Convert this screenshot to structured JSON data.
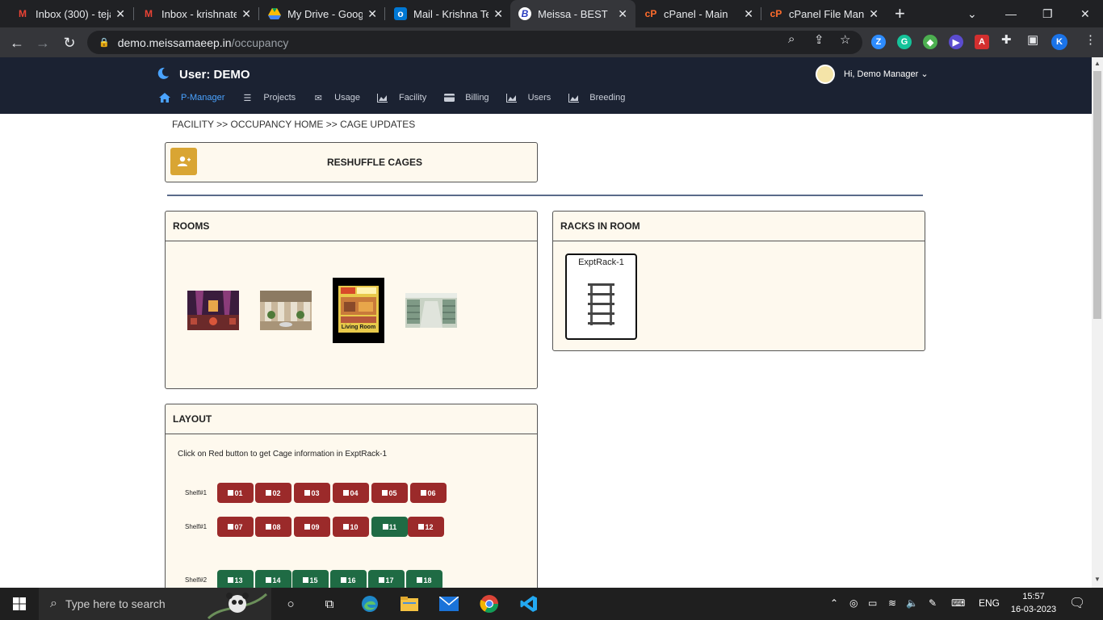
{
  "browser": {
    "tabs": [
      {
        "title": "Inbox (300) - teja",
        "icon": "gmail-icon",
        "active": false
      },
      {
        "title": "Inbox - krishnatej",
        "icon": "gmail-icon",
        "active": false
      },
      {
        "title": "My Drive - Googl",
        "icon": "drive-icon",
        "active": false
      },
      {
        "title": "Mail - Krishna Tej",
        "icon": "outlook-icon",
        "active": false
      },
      {
        "title": "Meissa - BEST",
        "icon": "meissa-icon",
        "active": true
      },
      {
        "title": "cPanel - Main",
        "icon": "cpanel-icon",
        "active": false
      },
      {
        "title": "cPanel File Manag",
        "icon": "cpanel-icon",
        "active": false
      }
    ],
    "url_host": "demo.meissamaeep.in",
    "url_path": "/occupancy",
    "profile_initial": "K"
  },
  "app": {
    "user_title": "User: DEMO",
    "greeting": "Hi, Demo Manager",
    "nav": [
      {
        "label": "P-Manager",
        "icon": "home-icon",
        "active": true
      },
      {
        "label": "Projects",
        "icon": "list-icon",
        "active": false
      },
      {
        "label": "Usage",
        "icon": "mail-icon",
        "active": false
      },
      {
        "label": "Facility",
        "icon": "chart-icon",
        "active": false
      },
      {
        "label": "Billing",
        "icon": "card-icon",
        "active": false
      },
      {
        "label": "Users",
        "icon": "chart-icon",
        "active": false
      },
      {
        "label": "Breeding",
        "icon": "chart-icon",
        "active": false
      }
    ]
  },
  "page": {
    "breadcrumb": "FACILITY >> OCCUPANCY HOME >> CAGE UPDATES",
    "reshuffle_label": "RESHUFFLE CAGES",
    "rooms_title": "ROOMS",
    "racks_title": "RACKS IN ROOM",
    "rack_name": "ExptRack-1",
    "layout_title": "LAYOUT",
    "layout_hint": "Click on Red button to get Cage information in ExptRack-1",
    "room_poster_text": "Living Room",
    "shelves": [
      {
        "label": "Shelf#1",
        "cages": [
          {
            "num": "01",
            "status": "red"
          },
          {
            "num": "02",
            "status": "red"
          },
          {
            "num": "03",
            "status": "red"
          },
          {
            "num": "04",
            "status": "red"
          },
          {
            "num": "05",
            "status": "red"
          },
          {
            "num": "06",
            "status": "red"
          }
        ]
      },
      {
        "label": "Shelf#1",
        "cages": [
          {
            "num": "07",
            "status": "red"
          },
          {
            "num": "08",
            "status": "red"
          },
          {
            "num": "09",
            "status": "red"
          },
          {
            "num": "10",
            "status": "red"
          },
          {
            "num": "11",
            "status": "green"
          },
          {
            "num": "12",
            "status": "red"
          }
        ]
      },
      {
        "label": "Shelf#2",
        "cages": [
          {
            "num": "13",
            "status": "green"
          },
          {
            "num": "14",
            "status": "green"
          },
          {
            "num": "15",
            "status": "green"
          },
          {
            "num": "16",
            "status": "green"
          },
          {
            "num": "17",
            "status": "green"
          },
          {
            "num": "18",
            "status": "green"
          }
        ]
      }
    ]
  },
  "taskbar": {
    "search_placeholder": "Type here to search",
    "lang": "ENG",
    "time": "15:57",
    "date": "16-03-2023"
  },
  "colors": {
    "header_bg": "#1b2232",
    "card_bg": "#fef9ee",
    "cage_red": "#9b2a2a",
    "cage_green": "#1f6b44",
    "accent_gold": "#d9a533",
    "nav_active": "#4aa3ff"
  }
}
